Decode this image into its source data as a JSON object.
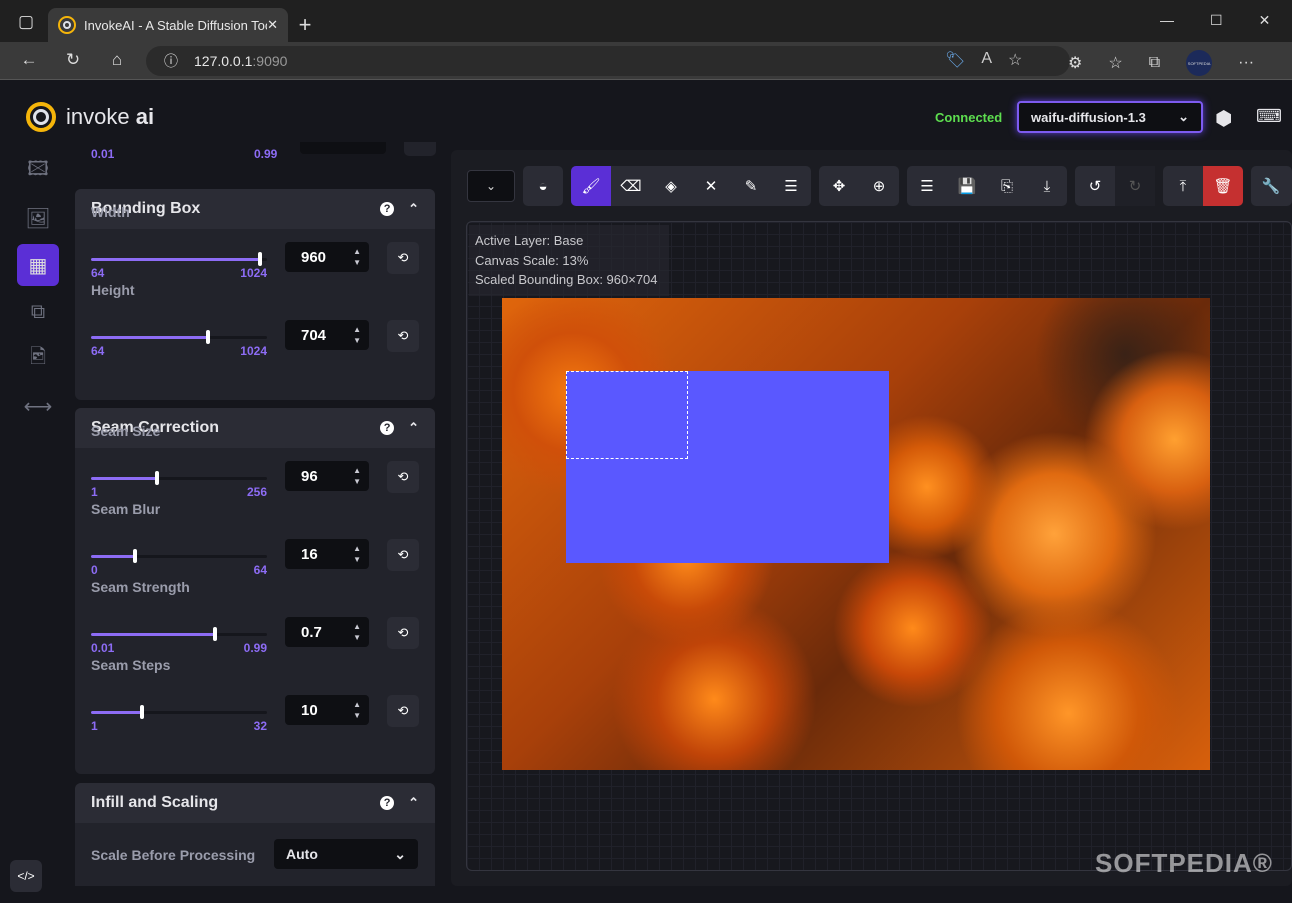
{
  "browser": {
    "tab_title": "InvokeAI - A Stable Diffusion Too",
    "url_host": "127.0.0.1",
    "url_port": ":9090",
    "profile": "SOFTPEDIA"
  },
  "header": {
    "logo_light": "invoke",
    "logo_bold": "ai",
    "status": "Connected",
    "model": "waifu-diffusion-1.3"
  },
  "top_partial": {
    "min": "0.01",
    "max": "0.99"
  },
  "bounding_box": {
    "title": "Bounding Box",
    "sliders": [
      {
        "label": "Width",
        "value": "960",
        "min": "64",
        "max": "1024",
        "fraction": 0.958
      },
      {
        "label": "Height",
        "value": "704",
        "min": "64",
        "max": "1024",
        "fraction": 0.667
      }
    ]
  },
  "seam": {
    "title": "Seam Correction",
    "sliders": [
      {
        "label": "Seam Size",
        "value": "96",
        "min": "1",
        "max": "256",
        "fraction": 0.373
      },
      {
        "label": "Seam Blur",
        "value": "16",
        "min": "0",
        "max": "64",
        "fraction": 0.25
      },
      {
        "label": "Seam Strength",
        "value": "0.7",
        "min": "0.01",
        "max": "0.99",
        "fraction": 0.704
      },
      {
        "label": "Seam Steps",
        "value": "10",
        "min": "1",
        "max": "32",
        "fraction": 0.29
      }
    ]
  },
  "infill": {
    "title": "Infill and Scaling",
    "scale_label": "Scale Before Processing",
    "scale_value": "Auto"
  },
  "canvas_info": {
    "layer": "Active Layer: Base",
    "scale": "Canvas Scale: 13%",
    "bbox": "Scaled Bounding Box: 960×704"
  },
  "colors": {
    "accent": "#7d5bf0",
    "active_tool": "#5b2fd6",
    "danger": "#c53030",
    "connected": "#5dde4f",
    "bbox_fill": "#5a58ff"
  },
  "watermark": "SOFTPEDIA"
}
